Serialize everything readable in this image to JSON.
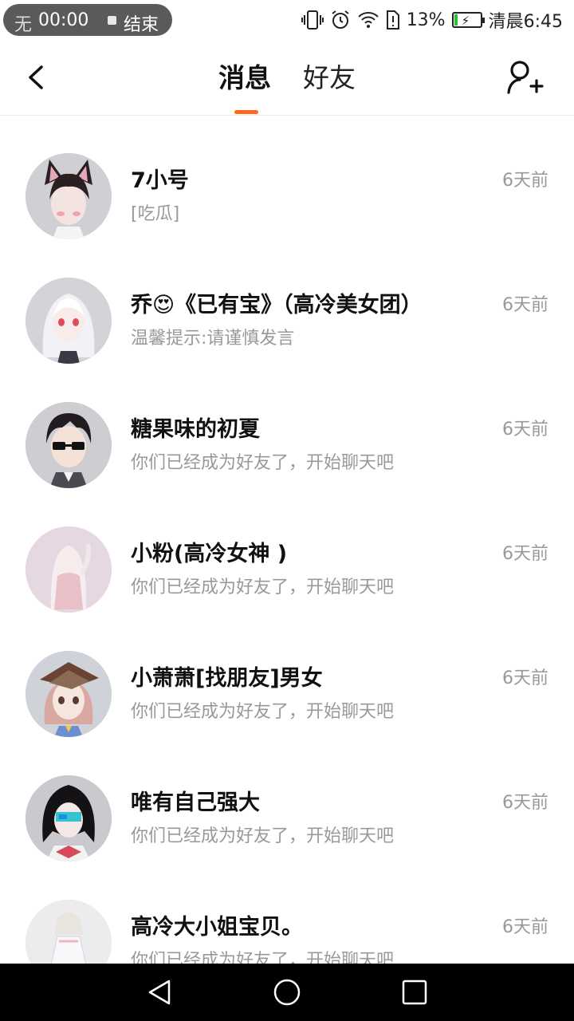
{
  "status_bar": {
    "recording_underlay": "无",
    "recording_time": "00:00",
    "recording_stop": "结束",
    "battery_percent": "13%",
    "battery_level": 0.13,
    "clock": "清晨6:45",
    "icons": [
      "vibrate-icon",
      "alarm-icon",
      "wifi-icon",
      "sim-icon",
      "battery-icon"
    ]
  },
  "header": {
    "tabs": [
      {
        "label": "消息",
        "active": true
      },
      {
        "label": "好友",
        "active": false
      }
    ],
    "accent_color": "#ff6a1c",
    "icons": [
      "back-arrow-icon",
      "add-friend-icon"
    ]
  },
  "conversations": [
    {
      "name": "7小号",
      "preview": "[吃瓜]",
      "time": "6天前",
      "avatar_icon": "avatar-cat-ear-boy"
    },
    {
      "name": "乔😍《已有宝》（高冷美女团）",
      "preview": "温馨提示:请谨慎发言",
      "time": "6天前",
      "avatar_icon": "avatar-white-hair-girl"
    },
    {
      "name": "糖果味的初夏",
      "preview": "你们已经成为好友了，开始聊天吧",
      "time": "6天前",
      "avatar_icon": "avatar-sunglasses-boy"
    },
    {
      "name": "小粉(高冷女神 )",
      "preview": "你们已经成为好友了，开始聊天吧",
      "time": "6天前",
      "avatar_icon": "avatar-pink-girl"
    },
    {
      "name": "小萧萧[找朋友]男女",
      "preview": "你们已经成为好友了，开始聊天吧",
      "time": "6天前",
      "avatar_icon": "avatar-hat-girl"
    },
    {
      "name": "唯有自己强大",
      "preview": "你们已经成为好友了，开始聊天吧",
      "time": "6天前",
      "avatar_icon": "avatar-dark-hair-masked"
    },
    {
      "name": "高冷大小姐宝贝。",
      "preview": "你们已经成为好友了，开始聊天吧",
      "time": "6天前",
      "avatar_icon": "avatar-white-dress-girl"
    }
  ],
  "nav_bar": {
    "icons": [
      "nav-back-icon",
      "nav-home-icon",
      "nav-recent-icon"
    ]
  }
}
